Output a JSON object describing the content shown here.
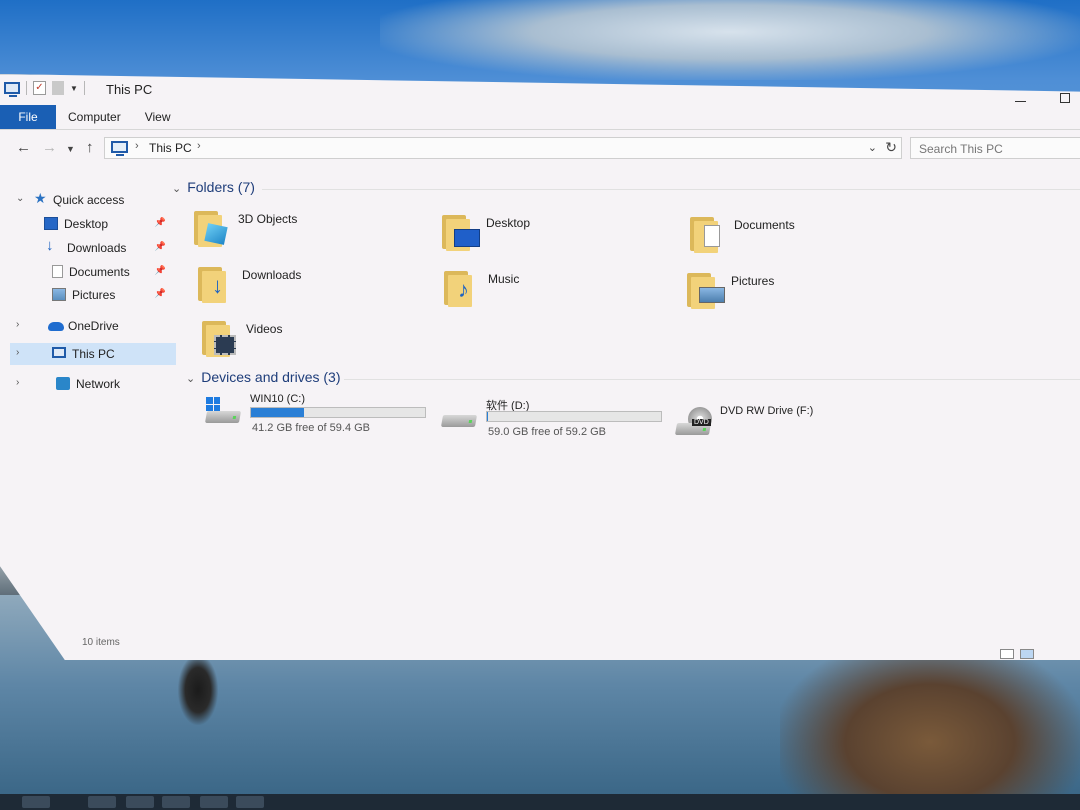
{
  "window": {
    "title": "This PC",
    "tabs": [
      "File",
      "Computer",
      "View"
    ]
  },
  "address": {
    "path": "This PC",
    "search_placeholder": "Search This PC"
  },
  "sidebar": {
    "items": [
      {
        "label": "Quick access",
        "icon": "star-icon"
      },
      {
        "label": "Desktop",
        "icon": "desktop-icon",
        "pinned": true
      },
      {
        "label": "Downloads",
        "icon": "download-arrow-icon",
        "pinned": true
      },
      {
        "label": "Documents",
        "icon": "document-icon",
        "pinned": true
      },
      {
        "label": "Pictures",
        "icon": "pictures-icon",
        "pinned": true
      },
      {
        "label": "OneDrive",
        "icon": "cloud-icon"
      },
      {
        "label": "This PC",
        "icon": "computer-icon",
        "selected": true
      },
      {
        "label": "Network",
        "icon": "network-icon"
      }
    ]
  },
  "folders": {
    "header": "Folders (7)",
    "items": [
      {
        "name": "3D Objects",
        "icon": "3d-objects-icon"
      },
      {
        "name": "Desktop",
        "icon": "desktop-icon"
      },
      {
        "name": "Documents",
        "icon": "documents-icon"
      },
      {
        "name": "Downloads",
        "icon": "download-arrow-icon"
      },
      {
        "name": "Music",
        "icon": "music-note-icon"
      },
      {
        "name": "Pictures",
        "icon": "pictures-icon"
      },
      {
        "name": "Videos",
        "icon": "film-icon"
      }
    ]
  },
  "drives": {
    "header": "Devices and drives (3)",
    "items": [
      {
        "name": "WIN10 (C:)",
        "free": "41.2 GB free of 59.4 GB",
        "used_fraction": 0.306,
        "icon": "windows-drive-icon"
      },
      {
        "name": "软件 (D:)",
        "free": "59.0 GB free of 59.2 GB",
        "used_fraction": 0.003,
        "icon": "hard-drive-icon"
      },
      {
        "name": "DVD RW Drive (F:)",
        "icon": "dvd-drive-icon"
      }
    ]
  },
  "status": {
    "items_count": "10 items"
  },
  "colors": {
    "accent": "#1a5fb4",
    "folder": "#f2d27a",
    "bar_fill": "#2a7fd6",
    "selection": "#cfe3f8"
  }
}
